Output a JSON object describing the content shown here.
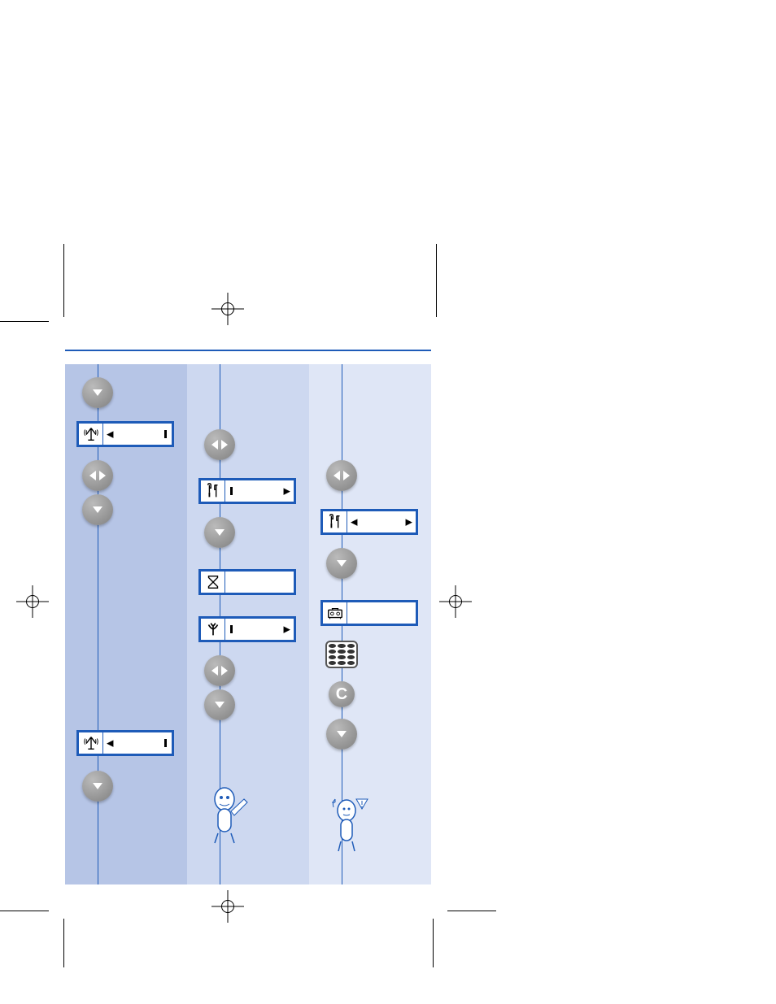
{
  "page": {
    "crop_marks": true,
    "registration_marks": [
      "top",
      "left",
      "right",
      "bottom"
    ]
  },
  "columns": [
    {
      "bg": "#b6c5e6",
      "steps": [
        {
          "type": "button-down"
        },
        {
          "type": "lcd",
          "icon": "antenna",
          "field": "left-arrow-right-bar"
        },
        {
          "type": "button-lr"
        },
        {
          "type": "button-down"
        },
        {
          "type": "gap"
        },
        {
          "type": "lcd",
          "icon": "antenna",
          "field": "left-arrow-right-bar"
        },
        {
          "type": "button-down"
        }
      ]
    },
    {
      "bg": "#cdd8f0",
      "steps": [
        {
          "type": "button-lr"
        },
        {
          "type": "lcd",
          "icon": "tools",
          "field": "left-bar-right-arrow"
        },
        {
          "type": "button-down"
        },
        {
          "type": "lcd",
          "icon": "hourglass",
          "field": "blank"
        },
        {
          "type": "lcd",
          "icon": "plant",
          "field": "left-bar-right-arrow"
        },
        {
          "type": "button-lr"
        },
        {
          "type": "button-down"
        },
        {
          "type": "mascot",
          "variant": "pencil"
        }
      ]
    },
    {
      "bg": "#dfe6f6",
      "steps": [
        {
          "type": "button-lr"
        },
        {
          "type": "lcd",
          "icon": "tools",
          "field": "left-arrow-right-arrow"
        },
        {
          "type": "button-down"
        },
        {
          "type": "lcd",
          "icon": "recorder",
          "field": "blank"
        },
        {
          "type": "keypad"
        },
        {
          "type": "c-button",
          "label": "C"
        },
        {
          "type": "button-down"
        },
        {
          "type": "mascot",
          "variant": "warning"
        }
      ]
    }
  ],
  "icons": {
    "antenna": "antenna-icon",
    "tools": "tools-icon",
    "hourglass": "hourglass-icon",
    "plant": "plant-icon",
    "recorder": "recorder-icon"
  },
  "c_label": "C"
}
